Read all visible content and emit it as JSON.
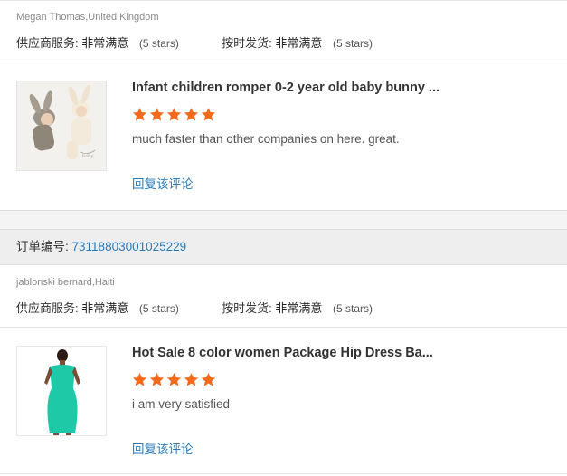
{
  "review1": {
    "buyer": "Megan Thomas,United Kingdom",
    "supplier_label": "供应商服务:",
    "supplier_value": "非常满意",
    "supplier_stars": "(5 stars)",
    "shipping_label": "按时发货:",
    "shipping_value": "非常满意",
    "shipping_stars": "(5 stars)",
    "product_title": "Infant children romper 0-2 year old baby bunny ...",
    "rating": 5,
    "comment": "much faster than other companies on here. great.",
    "reply_label": "回复该评论"
  },
  "order": {
    "label": "订单编号:",
    "number": "73118803001025229"
  },
  "review2": {
    "buyer": "jablonski bernard,Haiti",
    "supplier_label": "供应商服务:",
    "supplier_value": "非常满意",
    "supplier_stars": "(5 stars)",
    "shipping_label": "按时发货:",
    "shipping_value": "非常满意",
    "shipping_stars": "(5 stars)",
    "product_title": "Hot Sale 8 color women Package Hip Dress Ba...",
    "rating": 5,
    "comment": "i am very satisfied",
    "reply_label": "回复该评论"
  },
  "colors": {
    "star": "#f26b1d",
    "link": "#2a7ab8",
    "divider": "#e6e6e6"
  }
}
